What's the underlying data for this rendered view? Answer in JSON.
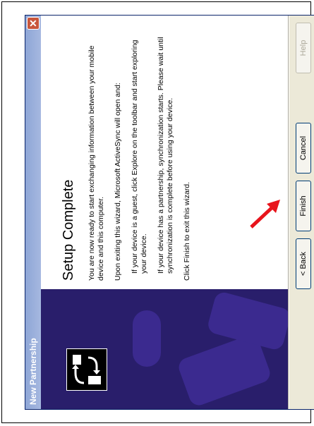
{
  "window": {
    "title": "New Partnership",
    "close_glyph": "✕"
  },
  "content": {
    "heading": "Setup Complete",
    "paragraphs": [
      "You are now ready to start exchanging information between your mobile device and this computer.",
      "Upon exiting this wizard, Microsoft ActiveSync will open and:",
      "If your device is a guest, click Explore on the toolbar and start exploring your device.",
      "If your device has a partnership, synchronization starts. Please wait until synchronization is complete before using your device.",
      "Click Finish to exit this wizard."
    ]
  },
  "buttons": {
    "back": "< Back",
    "finish": "Finish",
    "cancel": "Cancel",
    "help": "Help"
  },
  "colors": {
    "side_panel": "#291e6b",
    "titlebar": "#8ea6d6",
    "annotation_arrow": "#e8141c"
  }
}
